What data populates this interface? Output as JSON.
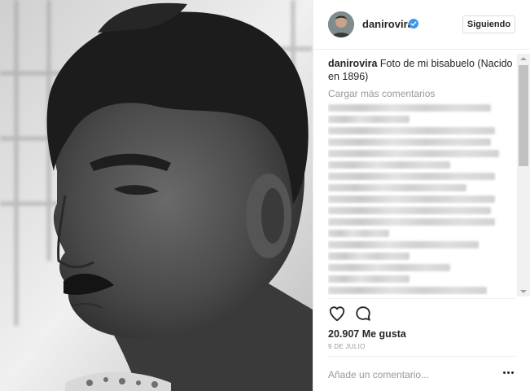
{
  "post": {
    "username": "danirovira",
    "follow_label": "Siguiendo",
    "caption_user": "danirovira",
    "caption_text": "Foto de mi bisabuelo (Nacido en 1896)",
    "load_more": "Cargar más comentarios",
    "likes": "20.907 Me gusta",
    "date": "9 DE JULIO",
    "comment_placeholder": "Añade un comentario..."
  },
  "blurred_comment_lines": 17,
  "icons": {
    "verified": "verified-badge-icon",
    "like": "heart-icon",
    "comment": "speech-bubble-icon",
    "more": "more-options-icon"
  },
  "colors": {
    "text": "#262626",
    "muted": "#999999",
    "verified": "#3897f0",
    "border": "#dbdbdb"
  }
}
